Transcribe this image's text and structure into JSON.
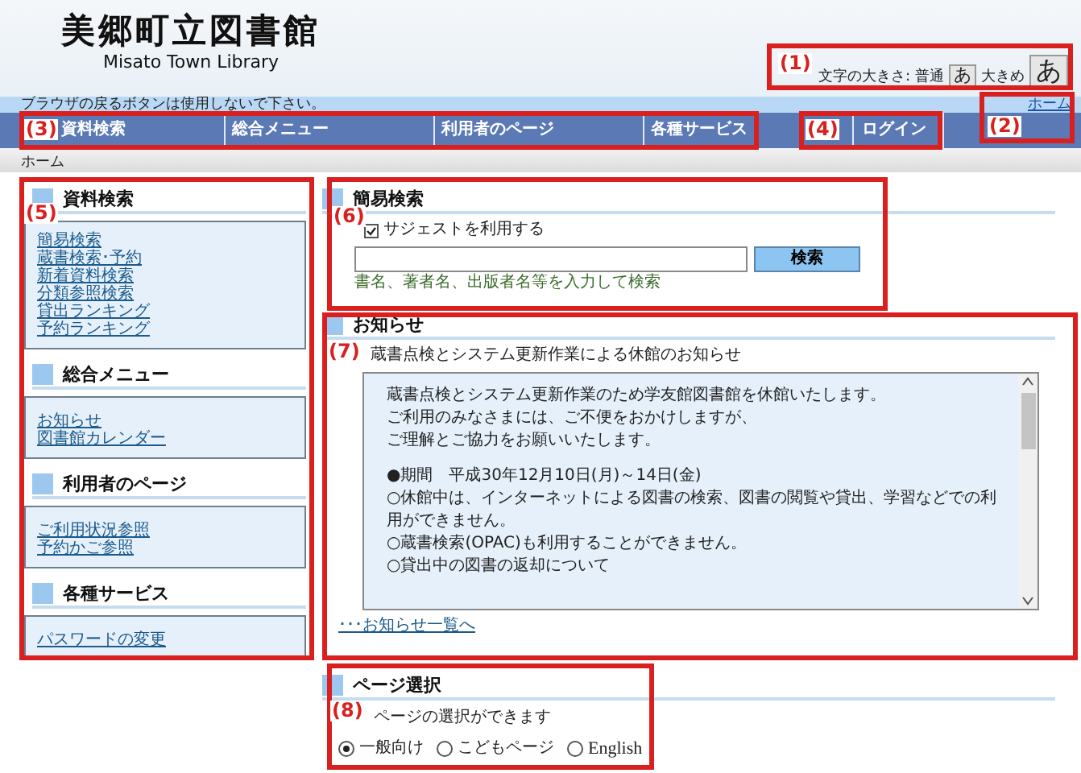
{
  "header": {
    "title": "美郷町立図書館",
    "subtitle": "Misato Town Library",
    "font_size": {
      "label": "文字の大きさ:",
      "options": [
        {
          "label": "普通",
          "key": "あ",
          "kind": "normal"
        },
        {
          "label": "大きめ",
          "key": "あ",
          "kind": "large"
        }
      ]
    }
  },
  "notice_bar": {
    "text": "ブラウザの戻るボタンは使用しないで下さい。",
    "home_link": "ホーム"
  },
  "nav": {
    "items": [
      "資料検索",
      "総合メニュー",
      "利用者のページ",
      "各種サービス"
    ],
    "login": "ログイン"
  },
  "breadcrumb": "ホーム",
  "sidebar": {
    "sections": [
      {
        "title": "資料検索",
        "links": [
          "簡易検索",
          "蔵書検索･予約",
          "新着資料検索",
          "分類参照検索",
          "貸出ランキング",
          "予約ランキング"
        ]
      },
      {
        "title": "総合メニュー",
        "links": [
          "お知らせ",
          "図書館カレンダー"
        ]
      },
      {
        "title": "利用者のページ",
        "links": [
          "ご利用状況参照",
          "予約かご参照"
        ]
      },
      {
        "title": "各種サービス",
        "links": [
          "パスワードの変更"
        ]
      }
    ]
  },
  "quick_search": {
    "title": "簡易検索",
    "suggest": {
      "label": "サジェストを利用する",
      "checked": true
    },
    "button": "検索",
    "hint": "書名、著者名、出版者名等を入力して検索"
  },
  "news": {
    "title": "お知らせ",
    "headline": "蔵書点検とシステム更新作業による休館のお知らせ",
    "intro": [
      "蔵書点検とシステム更新作業のため学友館図書館を休館いたします。",
      "ご利用のみなさまには、ご不便をおかけしますが、",
      "ご理解とご協力をお願いいたします。"
    ],
    "details": [
      "●期間　平成30年12月10日(月)～14日(金)",
      "○休館中は、インターネットによる図書の検索、図書の閲覧や貸出、学習などでの利用ができません。",
      "○蔵書検索(OPAC)も利用することができません。",
      "○貸出中の図書の返却について"
    ],
    "more": "･･･お知らせ一覧へ"
  },
  "page_select": {
    "title": "ページ選択",
    "description": "ページの選択ができます",
    "options": [
      {
        "label": "一般向け",
        "selected": true
      },
      {
        "label": "こどもページ",
        "selected": false
      },
      {
        "label": "English",
        "selected": false
      }
    ]
  },
  "annotations": [
    "(1)",
    "(3)",
    "(4)",
    "(2)",
    "(5)",
    "(6)",
    "(7)",
    "(8)"
  ]
}
